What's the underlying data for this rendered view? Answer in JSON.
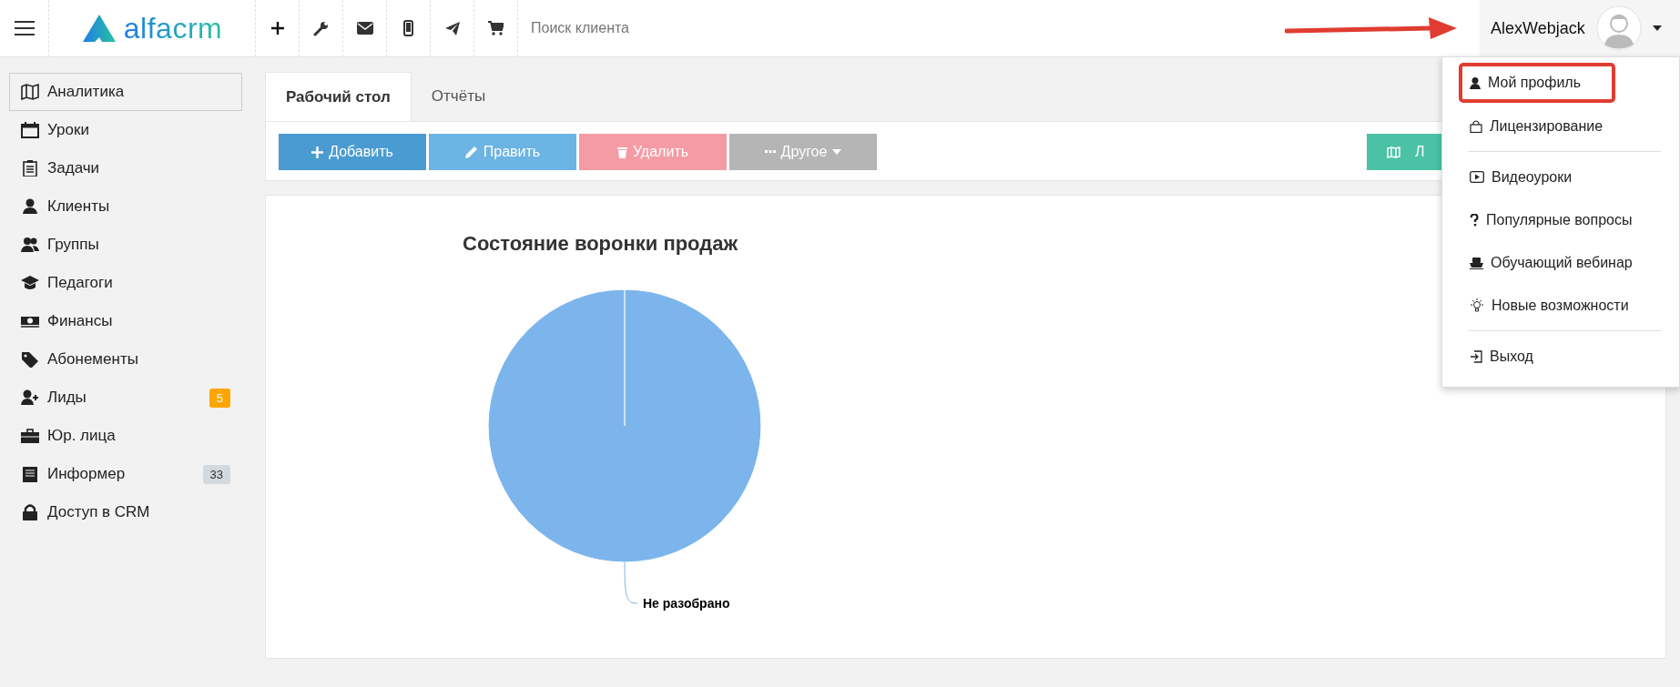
{
  "topbar": {
    "logo": "alfacrm",
    "search": {
      "placeholder": "Поиск клиента"
    },
    "user": {
      "name": "AlexWebjack"
    }
  },
  "sidebar": {
    "items": [
      {
        "label": "Аналитика",
        "selected": true
      },
      {
        "label": "Уроки",
        "selected": false
      },
      {
        "label": "Задачи",
        "selected": false
      },
      {
        "label": "Клиенты",
        "selected": false
      },
      {
        "label": "Группы",
        "selected": false
      },
      {
        "label": "Педагоги",
        "selected": false
      },
      {
        "label": "Финансы",
        "selected": false
      },
      {
        "label": "Абонементы",
        "selected": false
      },
      {
        "label": "Лиды",
        "selected": false,
        "badge": {
          "text": "5",
          "color": "#ffa500"
        }
      },
      {
        "label": "Юр. лица",
        "selected": false
      },
      {
        "label": "Информер",
        "selected": false,
        "badge": {
          "text": "33",
          "color": "#d2d9df"
        }
      },
      {
        "label": "Доступ в CRM",
        "selected": false
      }
    ]
  },
  "tabs": [
    {
      "label": "Рабочий стол",
      "selected": true
    },
    {
      "label": "Отчёты",
      "selected": false
    }
  ],
  "toolbar": {
    "buttons": [
      {
        "label": "Добавить",
        "kind": "primary"
      },
      {
        "label": "Править",
        "kind": "info"
      },
      {
        "label": "Удалить",
        "kind": "danger"
      },
      {
        "label": "Другое",
        "kind": "default"
      }
    ],
    "right_button": {
      "label": "Л",
      "kind": "success"
    }
  },
  "chart_panel": {
    "chart_data": {
      "type": "pie",
      "title": "Состояние воронки продаж",
      "categories": [
        "Не разобрано"
      ]
    }
  },
  "user_menu": {
    "groups": [
      [
        {
          "label": "Мой профиль",
          "highlighted": true
        },
        {
          "label": "Лицензирование",
          "highlighted": false
        }
      ],
      [
        {
          "label": "Видеоуроки",
          "highlighted": false
        },
        {
          "label": "Популярные вопросы",
          "highlighted": false
        },
        {
          "label": "Обучающий вебинар",
          "highlighted": false
        },
        {
          "label": "Новые возможности",
          "highlighted": false
        }
      ],
      [
        {
          "label": "Выход",
          "highlighted": false
        }
      ]
    ]
  },
  "annotation": {
    "arrow": true
  }
}
